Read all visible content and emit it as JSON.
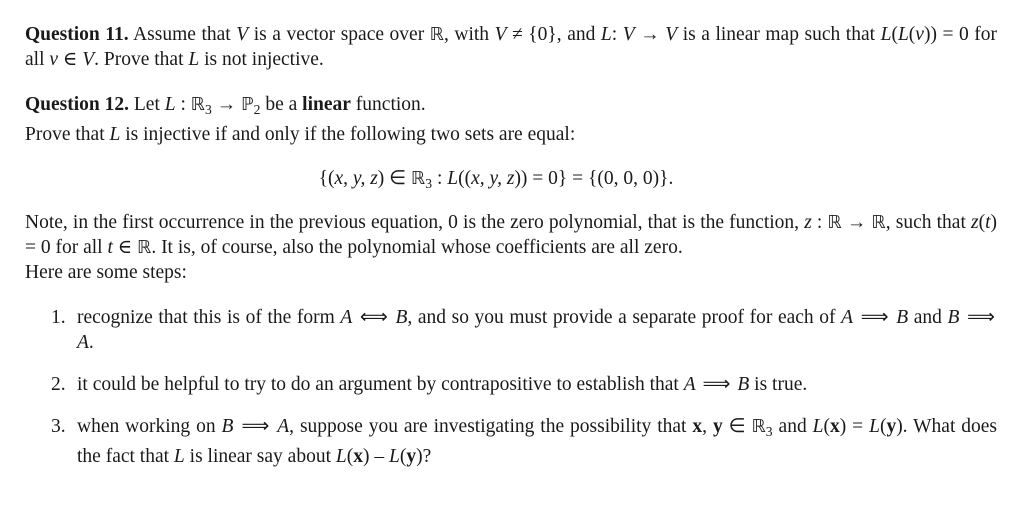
{
  "document": {
    "q11": {
      "label": "Question 11.",
      "segments": [
        {
          "t": " Assume that ",
          "k": "r"
        },
        {
          "t": "V",
          "k": "m"
        },
        {
          "t": " is a vector space over ",
          "k": "r"
        },
        {
          "t": "ℝ",
          "k": "bb"
        },
        {
          "t": ", with ",
          "k": "r"
        },
        {
          "t": "V",
          "k": "m"
        },
        {
          "t": " ≠ {0}",
          "k": "r"
        },
        {
          "t": ", and ",
          "k": "r"
        },
        {
          "t": "L",
          "k": "m"
        },
        {
          "t": ": ",
          "k": "r"
        },
        {
          "t": "V",
          "k": "m"
        },
        {
          "t": " → ",
          "k": "r"
        },
        {
          "t": "V",
          "k": "m"
        },
        {
          "t": " is a linear map such that ",
          "k": "r"
        },
        {
          "t": "L",
          "k": "m"
        },
        {
          "t": "(",
          "k": "r"
        },
        {
          "t": "L",
          "k": "m"
        },
        {
          "t": "(",
          "k": "r"
        },
        {
          "t": "v",
          "k": "m"
        },
        {
          "t": ")) = 0 for all ",
          "k": "r"
        },
        {
          "t": "v",
          "k": "m"
        },
        {
          "t": " ∈ ",
          "k": "r"
        },
        {
          "t": "V",
          "k": "m"
        },
        {
          "t": ". Prove that ",
          "k": "r"
        },
        {
          "t": "L",
          "k": "m"
        },
        {
          "t": " is not injective.",
          "k": "r"
        }
      ]
    },
    "q12": {
      "label": "Question 12.",
      "segments": [
        {
          "t": " Let ",
          "k": "r"
        },
        {
          "t": "L",
          "k": "m"
        },
        {
          "t": " : ",
          "k": "r"
        },
        {
          "t": "ℝ",
          "k": "bb"
        },
        {
          "t": "3",
          "k": "sub"
        },
        {
          "t": " → ",
          "k": "r"
        },
        {
          "t": "ℙ",
          "k": "bb"
        },
        {
          "t": "2",
          "k": "sub"
        },
        {
          "t": " be a ",
          "k": "r"
        },
        {
          "t": "linear",
          "k": "b"
        },
        {
          "t": " function.",
          "k": "r"
        },
        {
          "t": "\n",
          "k": "br"
        },
        {
          "t": "Prove that ",
          "k": "r"
        },
        {
          "t": "L",
          "k": "m"
        },
        {
          "t": " is injective if and only if the following two sets are equal:",
          "k": "r"
        }
      ]
    },
    "equation": {
      "segments": [
        {
          "t": "{(",
          "k": "r"
        },
        {
          "t": "x, y, z",
          "k": "m"
        },
        {
          "t": ") ∈ ",
          "k": "r"
        },
        {
          "t": "ℝ",
          "k": "bb"
        },
        {
          "t": "3",
          "k": "sub"
        },
        {
          "t": "  :  ",
          "k": "r"
        },
        {
          "t": "L",
          "k": "m"
        },
        {
          "t": "((",
          "k": "r"
        },
        {
          "t": "x, y, z",
          "k": "m"
        },
        {
          "t": ")) = 0} = {(0, 0, 0)}.",
          "k": "r"
        }
      ]
    },
    "note": {
      "segments": [
        {
          "t": "Note, in the first occurrence in the previous equation, 0 is the zero polynomial, that is the function, ",
          "k": "r"
        },
        {
          "t": "z",
          "k": "m"
        },
        {
          "t": " : ",
          "k": "r"
        },
        {
          "t": "ℝ",
          "k": "bb"
        },
        {
          "t": " → ",
          "k": "r"
        },
        {
          "t": "ℝ",
          "k": "bb"
        },
        {
          "t": ", such that ",
          "k": "r"
        },
        {
          "t": "z",
          "k": "m"
        },
        {
          "t": "(",
          "k": "r"
        },
        {
          "t": "t",
          "k": "m"
        },
        {
          "t": ") = 0 for all ",
          "k": "r"
        },
        {
          "t": "t",
          "k": "m"
        },
        {
          "t": " ∈ ",
          "k": "r"
        },
        {
          "t": "ℝ",
          "k": "bb"
        },
        {
          "t": ". It is, of course, also the polynomial whose coefficients are all zero.",
          "k": "r"
        },
        {
          "t": "\n",
          "k": "br"
        },
        {
          "t": "Here are some steps:",
          "k": "r"
        }
      ]
    },
    "steps": [
      {
        "number": "1.",
        "segments": [
          {
            "t": "recognize that this is of the form ",
            "k": "r"
          },
          {
            "t": "A",
            "k": "m"
          },
          {
            "t": " ⟺ ",
            "k": "sym"
          },
          {
            "t": "B",
            "k": "m"
          },
          {
            "t": ", and so you must provide a separate proof for each of ",
            "k": "r"
          },
          {
            "t": "A",
            "k": "m"
          },
          {
            "t": " ⟹ ",
            "k": "sym"
          },
          {
            "t": "B",
            "k": "m"
          },
          {
            "t": " and ",
            "k": "r"
          },
          {
            "t": "B",
            "k": "m"
          },
          {
            "t": " ⟹ ",
            "k": "sym"
          },
          {
            "t": "A",
            "k": "m"
          },
          {
            "t": ".",
            "k": "r"
          }
        ]
      },
      {
        "number": "2.",
        "segments": [
          {
            "t": "it could be helpful to try to do an argument by contrapositive to establish that ",
            "k": "r"
          },
          {
            "t": "A",
            "k": "m"
          },
          {
            "t": " ⟹ ",
            "k": "sym"
          },
          {
            "t": "B",
            "k": "m"
          },
          {
            "t": " is true.",
            "k": "r"
          }
        ]
      },
      {
        "number": "3.",
        "segments": [
          {
            "t": "when working on ",
            "k": "r"
          },
          {
            "t": "B",
            "k": "m"
          },
          {
            "t": "  ⟹  ",
            "k": "sym"
          },
          {
            "t": "A",
            "k": "m"
          },
          {
            "t": ", suppose you are investigating the possibility that ",
            "k": "r"
          },
          {
            "t": "x",
            "k": "bv"
          },
          {
            "t": ", ",
            "k": "r"
          },
          {
            "t": "y",
            "k": "bv"
          },
          {
            "t": " ∈ ",
            "k": "r"
          },
          {
            "t": "ℝ",
            "k": "bb"
          },
          {
            "t": "3",
            "k": "sub"
          },
          {
            "t": " and ",
            "k": "r"
          },
          {
            "t": "L",
            "k": "m"
          },
          {
            "t": "(",
            "k": "r"
          },
          {
            "t": "x",
            "k": "bv"
          },
          {
            "t": ") = ",
            "k": "r"
          },
          {
            "t": "L",
            "k": "m"
          },
          {
            "t": "(",
            "k": "r"
          },
          {
            "t": "y",
            "k": "bv"
          },
          {
            "t": "). What does the fact that ",
            "k": "r"
          },
          {
            "t": "L",
            "k": "m"
          },
          {
            "t": " is linear say about ",
            "k": "r"
          },
          {
            "t": "L",
            "k": "m"
          },
          {
            "t": "(",
            "k": "r"
          },
          {
            "t": "x",
            "k": "bv"
          },
          {
            "t": ") – ",
            "k": "r"
          },
          {
            "t": "L",
            "k": "m"
          },
          {
            "t": "(",
            "k": "r"
          },
          {
            "t": "y",
            "k": "bv"
          },
          {
            "t": ")?",
            "k": "r"
          }
        ]
      }
    ]
  }
}
